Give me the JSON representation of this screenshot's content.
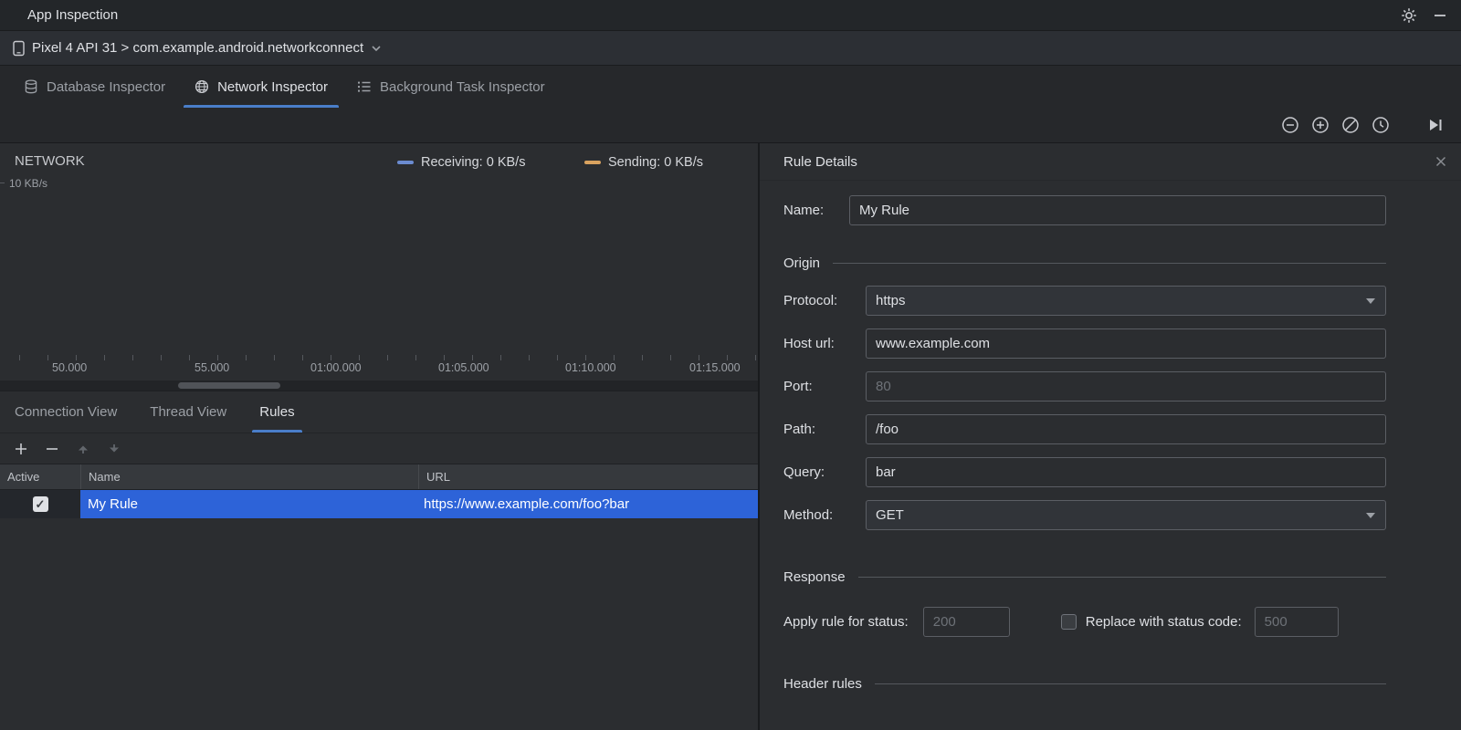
{
  "window": {
    "title": "App Inspection"
  },
  "device_bar": {
    "selector": "Pixel 4 API 31 > com.example.android.networkconnect"
  },
  "inspector_tabs": {
    "database": "Database Inspector",
    "network": "Network Inspector",
    "background": "Background Task Inspector"
  },
  "timeline": {
    "track_label": "NETWORK",
    "y_axis_max": "10 KB/s",
    "legend": {
      "receiving": "Receiving: 0 KB/s",
      "sending": "Sending: 0 KB/s"
    },
    "ticks": [
      "50.000",
      "55.000",
      "01:00.000",
      "01:05.000",
      "01:10.000",
      "01:15.000"
    ]
  },
  "view_tabs": {
    "connection": "Connection View",
    "thread": "Thread View",
    "rules": "Rules"
  },
  "rules_table": {
    "columns": {
      "active": "Active",
      "name": "Name",
      "url": "URL"
    },
    "rows": [
      {
        "active": true,
        "name": "My Rule",
        "url": "https://www.example.com/foo?bar"
      }
    ]
  },
  "rule_details": {
    "title": "Rule Details",
    "name_label": "Name:",
    "name_value": "My Rule",
    "sections": {
      "origin": "Origin",
      "response": "Response",
      "header_rules": "Header rules"
    },
    "origin_fields": {
      "protocol": {
        "label": "Protocol:",
        "value": "https"
      },
      "host": {
        "label": "Host url:",
        "value": "www.example.com"
      },
      "port": {
        "label": "Port:",
        "placeholder": "80"
      },
      "path": {
        "label": "Path:",
        "value": "/foo"
      },
      "query": {
        "label": "Query:",
        "value": "bar"
      },
      "method": {
        "label": "Method:",
        "value": "GET"
      }
    },
    "response": {
      "apply_label": "Apply rule for status:",
      "apply_placeholder": "200",
      "replace_label": "Replace with status code:",
      "replace_placeholder": "500"
    }
  },
  "icons": {
    "check": "✓"
  },
  "colors": {
    "selection_blue": "#2D63D8",
    "tab_underline_blue": "#4A7EC9",
    "receiving_legend": "#6B8BD0",
    "sending_legend": "#D9A25F"
  }
}
